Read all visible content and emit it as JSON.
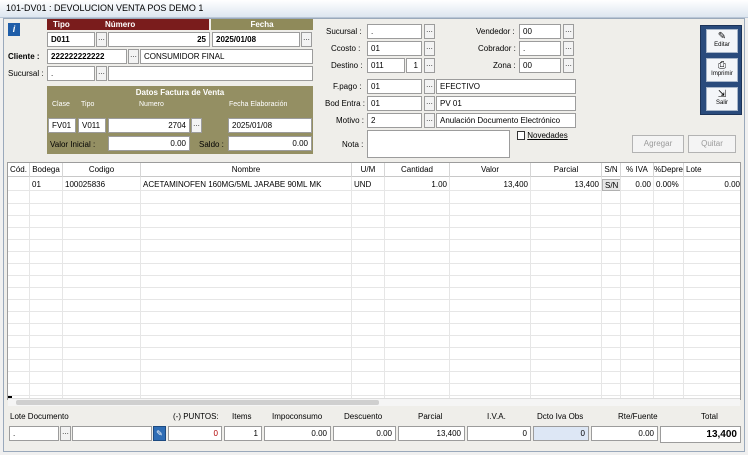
{
  "window": {
    "title": "101-DV01 : DEVOLUCION VENTA POS DEMO 1"
  },
  "doc": {
    "tipo_label": "Tipo",
    "numero_label": "Número",
    "fecha_label": "Fecha",
    "tipo": "D011",
    "numero": "25",
    "fecha": "2025/01/08",
    "dots": "..."
  },
  "cliente": {
    "label": "Cliente :",
    "nit": "222222222222",
    "nombre": "CONSUMIDOR FINAL",
    "sucursal_label": "Sucursal :",
    "sucursal": "."
  },
  "factura": {
    "title": "Datos Factura de Venta",
    "clase_label": "Clase",
    "tipo_label": "Tipo",
    "numero_label": "Numero",
    "fecha_label": "Fecha Elaboración",
    "clase": "FV01",
    "tipo": "V011",
    "numero": "2704",
    "fecha": "2025/01/08",
    "valor_inicial_label": "Valor Inicial :",
    "valor_inicial": "0.00",
    "saldo_label": "Saldo :",
    "saldo": "0.00"
  },
  "center": {
    "sucursal_label": "Sucursal :",
    "sucursal": ".",
    "ccosto_label": "Ccosto :",
    "ccosto": "01",
    "destino_label": "Destino :",
    "destino": "011",
    "destino_n": "1",
    "vendedor_label": "Vendedor :",
    "vendedor": "00",
    "cobrador_label": "Cobrador :",
    "cobrador": ".",
    "zona_label": "Zona :",
    "zona": "00",
    "fpago_label": "F.pago :",
    "fpago": "01",
    "fpago_desc": "EFECTIVO",
    "bod_label": "Bod Entra :",
    "bod": "01",
    "bod_desc": "PV 01",
    "motivo_label": "Motivo :",
    "motivo": "2",
    "motivo_desc": "Anulación Documento Electrónico",
    "nota_label": "Nota :",
    "novedades": "Novedades"
  },
  "sidebar": {
    "editar": "Editar",
    "imprimir": "Imprimir",
    "salir": "Salir"
  },
  "buttons": {
    "agregar": "Agregar",
    "quitar": "Quitar"
  },
  "table": {
    "headers": [
      "Cód.",
      "Bodega",
      "Codigo",
      "Nombre",
      "U/M",
      "Cantidad",
      "Valor",
      "Parcial",
      "S/N",
      "% IVA",
      "%Depre",
      "Lote"
    ],
    "rows": [
      {
        "bodega": "01",
        "codigo": "100025836",
        "nombre": "ACETAMINOFEN 160MG/5ML JARABE 90ML MK",
        "um": "UND",
        "cantidad": "1.00",
        "valor": "13,400",
        "parcial": "13,400",
        "sn": "S/N",
        "iva": "0.00",
        "depre": "0.00%",
        "lote": "0.00"
      }
    ]
  },
  "footer": {
    "lote_label": "Lote Documento",
    "lote": ".",
    "puntos_label": "(-) PUNTOS:",
    "puntos": "0",
    "items_label": "Items",
    "items": "1",
    "impoconsumo_label": "Impoconsumo",
    "impoconsumo": "0.00",
    "descuento_label": "Descuento",
    "descuento": "0.00",
    "parcial_label": "Parcial",
    "parcial": "13,400",
    "iva_label": "I.V.A.",
    "iva": "0",
    "dcto_label": "Dcto Iva Obs",
    "dcto": "0",
    "rte_label": "Rte/Fuente",
    "rte": "0.00",
    "total_label": "Total",
    "total": "13,400"
  }
}
